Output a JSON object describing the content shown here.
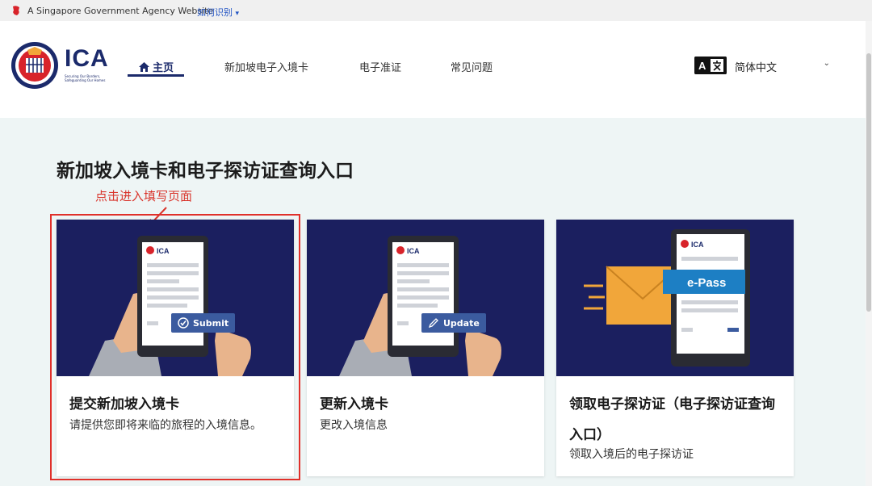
{
  "gov_bar": {
    "text": "A Singapore Government Agency Website",
    "link": "如何识别",
    "chevron": "chevron-down-icon"
  },
  "logo": {
    "name": "ICA",
    "subtitle": "Securing Our Borders, Safeguarding Our Homes"
  },
  "nav": {
    "home": "主页",
    "items": [
      "新加坡电子入境卡",
      "电子准证",
      "常见问题"
    ]
  },
  "language": {
    "selected": "简体中文",
    "icon": "translate-icon"
  },
  "page_title": "新加坡入境卡和电子探访证查询入口",
  "annotation": "点击进入填写页面",
  "cards": [
    {
      "title": "提交新加坡入境卡",
      "description": "请提供您即将来临的旅程的入境信息。",
      "button": "Submit",
      "phone_logo": "ICA"
    },
    {
      "title": "更新入境卡",
      "description": "更改入境信息",
      "button": "Update",
      "phone_logo": "ICA"
    },
    {
      "title": "领取电子探访证（电子探访证查询入口）",
      "description": "领取入境后的电子探访证",
      "banner": "e-Pass",
      "phone_logo": "ICA"
    }
  ],
  "colors": {
    "navy": "#1b1f5f",
    "brand": "#1b2a6b",
    "accent_button": "#3b5b9f",
    "annotation_red": "#d9342b",
    "epass_blue": "#1d7fc4",
    "envelope": "#f1a63a"
  }
}
